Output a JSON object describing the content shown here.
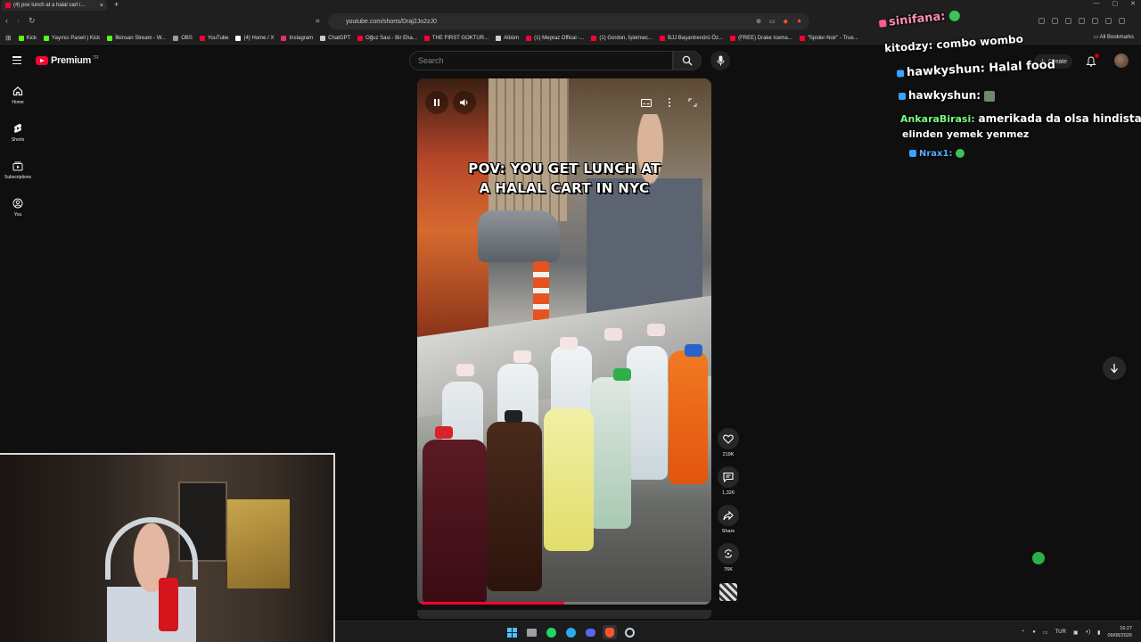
{
  "browser": {
    "tab_title": "(4) pov lunch at a halal cart i...",
    "url": "youtube.com/shorts/Draj2Jo2zJ0",
    "bookmarks": [
      "Kick",
      "Yayıncı Paneli | Kick",
      "İlkinsan Stream - W...",
      "OBS",
      "YouTube",
      "(4) Home / X",
      "Instagram",
      "ChatGPT",
      "Oğuz Sasi - Bir Eha...",
      "THE FIRST GOKTUR...",
      "Albüm",
      "(1) Mepraz Offical -...",
      "(1) Gordon, İşletmec...",
      "BJJ Başantrenörü Öz...",
      "(FREE) Drake Icema...",
      "\"Spider-Noir\" - True..."
    ],
    "all_bookmarks": "All Bookmarks",
    "bookmark_colors": [
      "#53fc18",
      "#53fc18",
      "#53fc18",
      "#9c9c9c",
      "#ff0033",
      "#ffffff",
      "#e1306c",
      "#cccccc",
      "#ff0033",
      "#ff0033",
      "#cccccc",
      "#ff0033",
      "#ff0033",
      "#ff0033",
      "#ff0033",
      "#ff0033"
    ]
  },
  "youtube": {
    "logo_text": "Premium",
    "logo_sup": "TR",
    "search_placeholder": "Search",
    "create_label": "Create",
    "guide": [
      {
        "icon": "home-icon",
        "label": "Home"
      },
      {
        "icon": "shorts-icon",
        "label": "Shorts"
      },
      {
        "icon": "subscriptions-icon",
        "label": "Subscriptions"
      },
      {
        "icon": "you-icon",
        "label": "You"
      }
    ],
    "short": {
      "caption_line1": "POV: YOU GET LUNCH AT",
      "caption_line2": "A HALAL CART IN NYC",
      "progress_fraction": 0.5
    },
    "actions": [
      {
        "icon": "like-icon",
        "label": "219K"
      },
      {
        "icon": "comment-icon",
        "label": "1,326"
      },
      {
        "icon": "share-icon",
        "label": "Share"
      },
      {
        "icon": "remix-icon",
        "label": "76K"
      }
    ]
  },
  "chat": [
    {
      "user": "sinifana:",
      "message": "",
      "user_color": "#ff5c8a",
      "emote": true
    },
    {
      "user": "kitodzy:",
      "message": "combo wombo",
      "user_color": "#ffffff",
      "emote": false
    },
    {
      "user": "hawkyshun:",
      "message": "Halal food",
      "user_color": "#ffffff",
      "emote": false
    },
    {
      "user": "hawkyshun:",
      "message": "",
      "user_color": "#ffffff",
      "emote": true
    },
    {
      "user": "AnkaraBirasi:",
      "message": "amerikada da olsa hindistanlı",
      "user_color": "#7dff7d",
      "emote": false
    },
    {
      "user": "",
      "message": "elinden yemek yenmez",
      "user_color": "#ffffff",
      "emote": false
    },
    {
      "user": "Nrax1:",
      "message": "",
      "user_color": "#5aa9ff",
      "emote": true
    }
  ],
  "taskbar": {
    "lang": "TUR",
    "time": "16:27",
    "date": "09/08/2026"
  }
}
